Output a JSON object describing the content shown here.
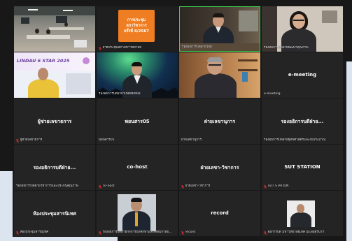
{
  "colors": {
    "background": "#181818",
    "tile": "#242424",
    "active_border": "#3ccf4e",
    "mute_icon": "#e5322d",
    "label_text": "#e6e6e6",
    "name_text": "#ffffff",
    "screen_edge": "#dce5ef"
  },
  "icons": {
    "muted": "mic-off-icon"
  },
  "tiles": [
    {
      "type": "video"
    },
    {
      "type": "video",
      "label": "ฝ่ายประชุมสภามหาวิทยาลัย",
      "muted": true,
      "card_lines": [
        "การประชุม",
        "สภาวิชาการ",
        "ครั้งที่ 8/2567"
      ]
    },
    {
      "type": "video",
      "label": "รองอธิการบดีฝ่ายวิจัย",
      "muted": false,
      "active": true
    },
    {
      "type": "video",
      "label": "รองอธิการบดีฝ่ายพัฒนาคุณภาพ",
      "muted": false
    },
    {
      "type": "video",
      "banner_text": "LINDAU 6 STAR 2025"
    },
    {
      "type": "video",
      "label": "รองอธิการบดีฝ่ายวิเทศสัมพันธ์",
      "muted": false
    },
    {
      "type": "video"
    },
    {
      "type": "name",
      "name": "e-meeting",
      "label": "e-meeting",
      "muted": false
    },
    {
      "type": "name",
      "name": "ผู้ช่วยเลขาธการ",
      "label": "ผู้ช่วยเลขาธการ",
      "muted": true
    },
    {
      "type": "name",
      "name": "พยนสาร05",
      "label": "พยนสาร05",
      "muted": false
    },
    {
      "type": "name",
      "name": "ฝ่ายเลขานุการ",
      "label": "ฝ่ายเลขานุการ",
      "muted": false
    },
    {
      "type": "name",
      "name": "รองอธิการบดีฝ่าย...",
      "label": "รองอธิการบดีฝ่ายยุทธศาสตร์และงบประมาณ",
      "muted": false
    },
    {
      "type": "name",
      "name": "รองอธิการบดีฝ่าย...",
      "label": "รองอธิการบดีฝ่ายวิชาการและประกันคุณภาพ",
      "muted": false
    },
    {
      "type": "name",
      "name": "co-host",
      "label": "co-host",
      "muted": true
    },
    {
      "type": "name",
      "name": "ฝ่ายเลขา-วิชาการ",
      "label": "ฝ่ายเลขา-วิชาการ",
      "muted": true
    },
    {
      "type": "name",
      "name": "SUT STATION",
      "label": "SUT STATION",
      "muted": true
    },
    {
      "type": "name",
      "name": "ห้องประชุมสารนิเทศ",
      "label": "ห้องประชุมสารนิเทศ",
      "muted": true
    },
    {
      "type": "video",
      "label": "รองอธิการบดีฝ่ายกิจการนักศึกษาและศิษย์เก่าสัมพันธ์",
      "muted": true
    },
    {
      "type": "name",
      "name": "record",
      "label": "record",
      "muted": true
    },
    {
      "type": "video",
      "label": "อธิการบดี มหาวิทยาลัยเทคโนโลยีสุรนารี",
      "muted": true
    }
  ]
}
